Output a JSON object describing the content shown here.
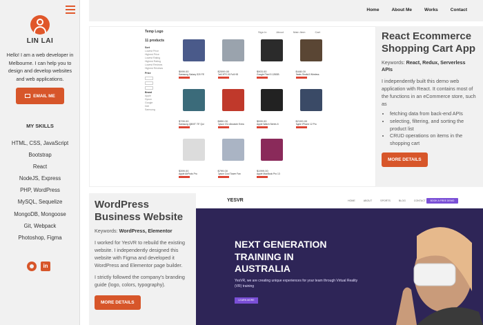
{
  "sidebar": {
    "name": "LIN LAI",
    "intro": "Hello! I am a web developer in Melbourne. I can help you to design and develop websites and web applications.",
    "email_label": "EMAIL ME",
    "skills_heading": "MY SKILLS",
    "skills": [
      "HTML, CSS, JavaScript",
      "Bootstrap",
      "React",
      "NodeJS, Express",
      "PHP, WordPress",
      "MySQL, Sequelize",
      "MongoDB, Mongoose",
      "Git, Webpack",
      "Photoshop, Figma"
    ]
  },
  "nav": {
    "items": [
      "Home",
      "About Me",
      "Works",
      "Contact"
    ]
  },
  "project1": {
    "title": "React Ecommerce Shopping Cart App",
    "keywords_label": "Keywords: ",
    "keywords": "React, Redux, Serverless APIs",
    "description": "I independently built this demo web application with React. It contains most of the functions in an eCommerce store, such as",
    "bullets": [
      "fetching data from back-end APIs",
      "selecting, filtering, and sorting the product list",
      "CRUD operations on items in the shopping cart"
    ],
    "button": "MORE DETAILS",
    "screenshot": {
      "logo": "Temp Logo",
      "nav": [
        "Sign In",
        "About",
        "Main Item",
        "Cart"
      ],
      "count": "11 products",
      "filters": {
        "sort_label": "Sort",
        "sort_options": [
          "Lowest Price",
          "Highest Price",
          "Lowest Rating",
          "Highest Rating",
          "Lowest Reviews",
          "Highest Reviews"
        ],
        "price_label": "Price",
        "brand_label": "Brand",
        "brands": [
          "Apple",
          "Dyson",
          "Google",
          "Dell",
          "Samsung"
        ]
      },
      "products": [
        {
          "price": "$999.00",
          "name": "Samsung Galaxy S20 FE",
          "color": "#4a5a8a"
        },
        {
          "price": "$2099.00",
          "name": "Dell XPS 15 Full HD",
          "color": "#9aa3ad"
        },
        {
          "price": "$903.00",
          "name": "Google Pixel 5 128GB",
          "color": "#2b2b2b"
        },
        {
          "price": "$448.00",
          "name": "Beats Studio3 Wireless",
          "color": "#5a4634"
        },
        {
          "price": "$799.00",
          "name": "Samsung Q800T 75\" Qui",
          "color": "#3b6b7a"
        },
        {
          "price": "$850.00",
          "name": "Dyson V11 Absolute Extra",
          "color": "#c0392b"
        },
        {
          "price": "$599.00",
          "name": "Apple Watch Series 6",
          "color": "#222222"
        },
        {
          "price": "$2199.00",
          "name": "Apple iPhone 12 Pro",
          "color": "#3a4a66"
        },
        {
          "price": "$399.00",
          "name": "Apple AirPods Pro",
          "color": "#dcdcdc"
        },
        {
          "price": "$799.00",
          "name": "Dyson Cool Tower Fan",
          "color": "#aab4c4"
        },
        {
          "price": "$1999.00",
          "name": "Apple MacBook Pro 13",
          "color": "#8a2a5a"
        }
      ]
    }
  },
  "project2": {
    "title": "WordPress Business Website",
    "keywords_label": "Keywords: ",
    "keywords": "WordPress, Elementor",
    "description1": "I worked for YesVR to rebuild the existing website. I independently designed this website with Figma and developed it WordPress and Elementor page builder.",
    "description2": "I strictly followed the company's branding guide (logo, colors, typography).",
    "button": "MORE DETAILS",
    "screenshot": {
      "logo": "YESVR",
      "nav": [
        "HOME",
        "ABOUT",
        "SPORTS",
        "BLOG",
        "CONTACT"
      ],
      "cta": "BOOK A FREE DEMO",
      "hero_title": "NEXT GENERATION TRAINING IN AUSTRALIA",
      "hero_subtitle": "YesVR, we are creating unique experiences for your team through Virtual Reality (VR) training",
      "hero_button": "LEARN MORE"
    }
  },
  "colors": {
    "accent": "#d7562a",
    "panel": "#f1f1f1",
    "hero_bg": "#2e2557",
    "purple": "#7a4fd6"
  }
}
